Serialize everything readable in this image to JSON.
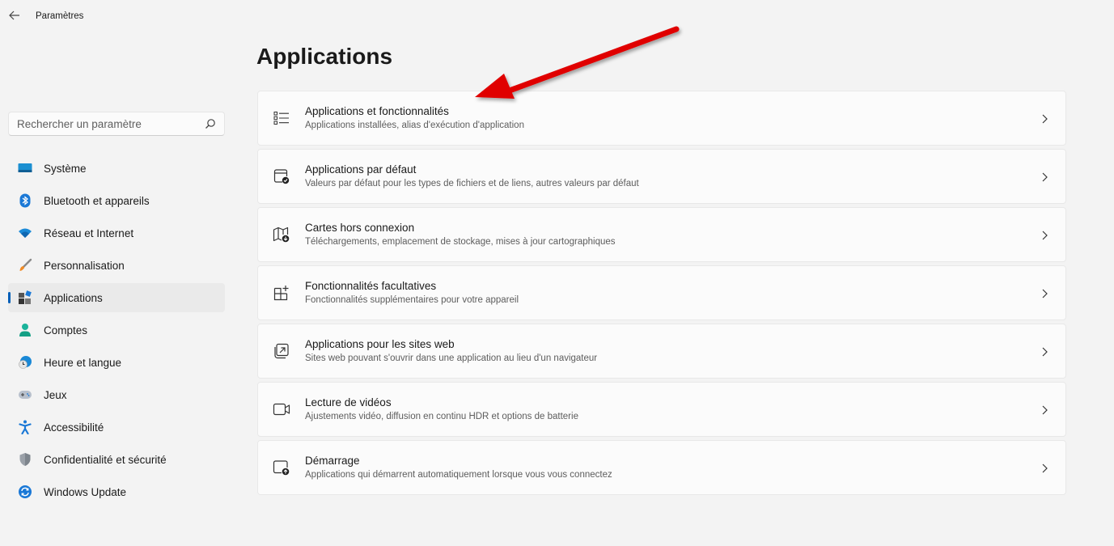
{
  "window": {
    "title": "Paramètres"
  },
  "search": {
    "placeholder": "Rechercher un paramètre",
    "value": ""
  },
  "sidebar": {
    "items": [
      {
        "label": "Système",
        "icon": "system-display-icon",
        "active": false
      },
      {
        "label": "Bluetooth et appareils",
        "icon": "bluetooth-icon",
        "active": false
      },
      {
        "label": "Réseau et Internet",
        "icon": "wifi-icon",
        "active": false
      },
      {
        "label": "Personnalisation",
        "icon": "paintbrush-icon",
        "active": false
      },
      {
        "label": "Applications",
        "icon": "apps-icon",
        "active": true
      },
      {
        "label": "Comptes",
        "icon": "person-icon",
        "active": false
      },
      {
        "label": "Heure et langue",
        "icon": "globe-clock-icon",
        "active": false
      },
      {
        "label": "Jeux",
        "icon": "gamepad-icon",
        "active": false
      },
      {
        "label": "Accessibilité",
        "icon": "accessibility-icon",
        "active": false
      },
      {
        "label": "Confidentialité et sécurité",
        "icon": "shield-icon",
        "active": false
      },
      {
        "label": "Windows Update",
        "icon": "update-icon",
        "active": false
      }
    ]
  },
  "main": {
    "title": "Applications",
    "cards": [
      {
        "title": "Applications et fonctionnalités",
        "subtitle": "Applications installées, alias d'exécution d'application",
        "icon": "list-icon"
      },
      {
        "title": "Applications par défaut",
        "subtitle": "Valeurs par défaut pour les types de fichiers et de liens, autres valeurs par défaut",
        "icon": "default-app-icon"
      },
      {
        "title": "Cartes hors connexion",
        "subtitle": "Téléchargements, emplacement de stockage, mises à jour cartographiques",
        "icon": "map-download-icon"
      },
      {
        "title": "Fonctionnalités facultatives",
        "subtitle": "Fonctionnalités supplémentaires pour votre appareil",
        "icon": "grid-add-icon"
      },
      {
        "title": "Applications pour les sites web",
        "subtitle": "Sites web pouvant s'ouvrir dans une application au lieu d'un navigateur",
        "icon": "open-in-app-icon"
      },
      {
        "title": "Lecture de vidéos",
        "subtitle": "Ajustements vidéo, diffusion en continu HDR et options de batterie",
        "icon": "video-camera-icon"
      },
      {
        "title": "Démarrage",
        "subtitle": "Applications qui démarrent automatiquement lorsque vous vous connectez",
        "icon": "startup-icon"
      }
    ]
  },
  "annotation": {
    "arrow_color": "#e00000",
    "points_to": "Applications et fonctionnalités"
  },
  "colors": {
    "accent": "#005fb8",
    "background": "#f3f3f3",
    "card": "#fbfbfb"
  }
}
